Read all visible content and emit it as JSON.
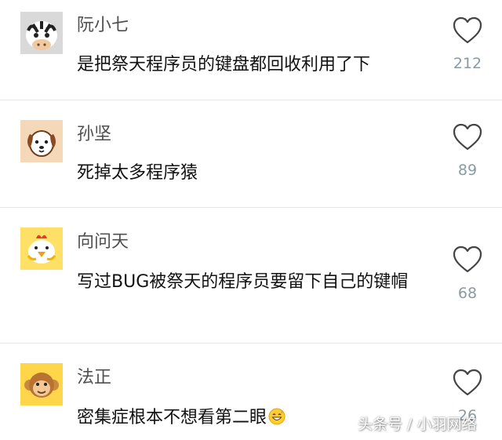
{
  "comments": [
    {
      "username": "阮小七",
      "text": "是把祭天程序员的键盘都回收利用了下",
      "likes": "212",
      "avatar_icon": "zebra-avatar-icon",
      "avatar_bg": "#d9d9d9"
    },
    {
      "username": "孙坚",
      "text": "死掉太多程序猿",
      "likes": "89",
      "avatar_icon": "dog-avatar-icon",
      "avatar_bg": "#f5d8b8"
    },
    {
      "username": "向问天",
      "text": "写过BUG被祭天的程序员要留下自己的键帽",
      "likes": "68",
      "avatar_icon": "chicken-avatar-icon",
      "avatar_bg": "#ffe066"
    },
    {
      "username": "法正",
      "text": "密集症根本不想看第二眼",
      "likes": "26",
      "avatar_icon": "monkey-avatar-icon",
      "avatar_bg": "#ffd54a",
      "trailing_emoji": "grinning-sweat-emoji"
    }
  ],
  "like_icon": "heart-outline-icon",
  "watermark": "头条号 / 小羽网络",
  "colors": {
    "username": "#4f4f4f",
    "text": "#111111",
    "like_count": "#8a9aa5",
    "divider": "#e6e6e6"
  }
}
